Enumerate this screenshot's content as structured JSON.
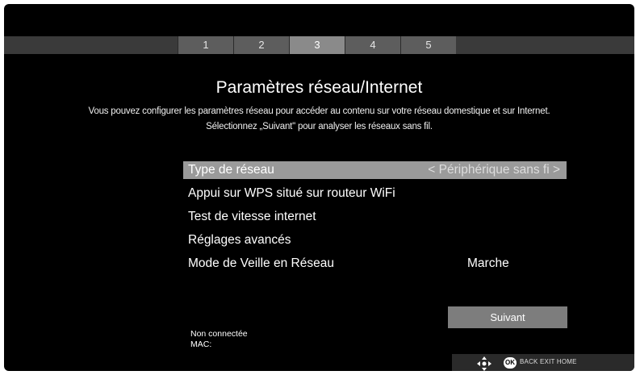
{
  "steps": [
    {
      "label": "1",
      "active": false
    },
    {
      "label": "2",
      "active": false
    },
    {
      "label": "3",
      "active": true
    },
    {
      "label": "4",
      "active": false
    },
    {
      "label": "5",
      "active": false
    }
  ],
  "page": {
    "title": "Paramètres réseau/Internet",
    "description_line1": "Vous pouvez configurer les paramètres réseau pour accéder au contenu sur votre réseau domestique et sur Internet.",
    "description_line2": "Sélectionnez „Suivant\" pour analyser les réseaux sans fil."
  },
  "menu": {
    "items": [
      {
        "label": "Type de réseau",
        "value": "< Périphérique sans fi >",
        "selected": true
      },
      {
        "label": "Appui sur WPS situé sur routeur WiFi",
        "value": "",
        "selected": false
      },
      {
        "label": "Test de vitesse internet",
        "value": "",
        "selected": false
      },
      {
        "label": "Réglages avancés",
        "value": "",
        "selected": false
      },
      {
        "label": "Mode de Veille en Réseau",
        "value": "Marche",
        "selected": false
      }
    ]
  },
  "next_button": {
    "label": "Suivant"
  },
  "status": {
    "connection": "Non connectée",
    "mac_label": "MAC:"
  },
  "hint_bar": {
    "ok_label": "OK",
    "text": "BACK EXIT HOME",
    "icons": [
      "dpad-icon",
      "ok-button-icon"
    ]
  },
  "colors": {
    "background": "#000000",
    "selected_row": "#9a9a9a",
    "active_step": "#8a8a8a",
    "inactive_step": "#5d5d5d",
    "button": "#7d7d7d"
  }
}
